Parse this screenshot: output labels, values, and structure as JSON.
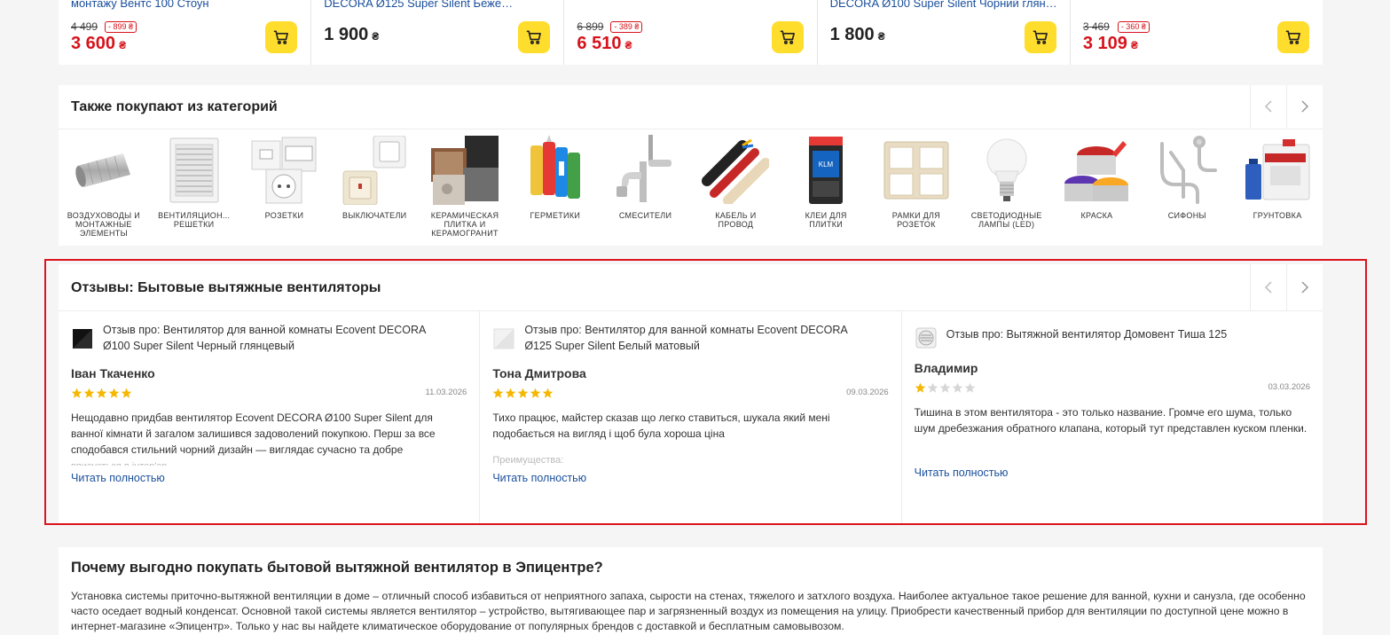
{
  "products": [
    {
      "name": "монтажу Вентс 100 Стоун",
      "old_price": "4 499",
      "discount": "- 899 ₴",
      "price": "3 600",
      "currency": "₴",
      "on_sale": true
    },
    {
      "name": "DECORA Ø125 Super Silent Бежеви...",
      "price": "1 900",
      "currency": "₴",
      "on_sale": false
    },
    {
      "name": "",
      "old_price": "6 899",
      "discount": "- 389 ₴",
      "price": "6 510",
      "currency": "₴",
      "on_sale": true
    },
    {
      "name": "DECORA Ø100 Super Silent Чорний глянцевий",
      "price": "1 800",
      "currency": "₴",
      "on_sale": false
    },
    {
      "name": "",
      "old_price": "3 469",
      "discount": "- 360 ₴",
      "price": "3 109",
      "currency": "₴",
      "on_sale": true
    }
  ],
  "categories": {
    "title": "Также покупают из категорий",
    "items": [
      {
        "label": "Воздуховоды и монтажные элементы",
        "icon": "duct-icon"
      },
      {
        "label": "Вентиляцион... решетки",
        "icon": "vent-grille-icon"
      },
      {
        "label": "Розетки",
        "icon": "socket-icon"
      },
      {
        "label": "Выключатели",
        "icon": "switch-icon"
      },
      {
        "label": "Керамическая плитка и керамогранит",
        "icon": "tile-icon"
      },
      {
        "label": "Герметики",
        "icon": "sealant-icon"
      },
      {
        "label": "Смесители",
        "icon": "faucet-icon"
      },
      {
        "label": "Кабель и провод",
        "icon": "cable-icon"
      },
      {
        "label": "Клеи для плитки",
        "icon": "glue-bag-icon"
      },
      {
        "label": "Рамки для розеток",
        "icon": "frame-icon"
      },
      {
        "label": "Светодиодные лампы (LED)",
        "icon": "led-bulb-icon"
      },
      {
        "label": "Краска",
        "icon": "paint-icon"
      },
      {
        "label": "Сифоны",
        "icon": "siphon-icon"
      },
      {
        "label": "Грунтовка",
        "icon": "primer-icon"
      }
    ]
  },
  "reviews": {
    "title": "Отзывы: Бытовые вытяжные вентиляторы",
    "read_more": "Читать полностью",
    "items": [
      {
        "product": "Отзыв про: Вентилятор для ванной комнаты Ecovent DECORA Ø100 Super Silent Черный глянцевый",
        "author": "Іван Ткаченко",
        "rating": 5,
        "date": "11.03.2026",
        "text": "Нещодавно придбав вентилятор Ecovent DECORA Ø100 Super Silent для ванної кімнати й загалом залишився задоволений покупкою. Перш за все сподобався стильний чорний дизайн — виглядає сучасно та добре",
        "fade": "вписується в інтер'єр",
        "thumb": "black"
      },
      {
        "product": "Отзыв про: Вентилятор для ванной комнаты Ecovent DECORA Ø125 Super Silent Белый матовый",
        "author": "Тона Дмитрова",
        "rating": 5,
        "date": "09.03.2026",
        "text": "Тихо працює, майстер сказав що легко ставиться, шукала який мені подобається на вигляд і щоб була хороша ціна",
        "fade": "Преимущества:",
        "thumb": "white"
      },
      {
        "product": "Отзыв про: Вытяжной вентилятор Домовент Тиша 125",
        "author": "Владимир",
        "rating": 1,
        "date": "03.03.2026",
        "text": "Тишина в этом вентилятора - это только название. Громче его шума, только шум дребезжания обратного клапана, который тут представлен куском пленки.",
        "fade": "",
        "thumb": "grille"
      }
    ]
  },
  "why": {
    "title": "Почему выгодно покупать бытовой вытяжной вентилятор в Эпицентре?",
    "text": "Установка системы приточно-вытяжной вентиляции в доме – отличный способ избавиться от неприятного запаха, сырости на стенах, тяжелого и затхлого воздуха. Наиболее актуальное такое решение для ванной, кухни и санузла, где особенно часто оседает водный конденсат. Основной такой системы является вентилятор – устройство, вытягивающее пар и загрязненный воздух из помещения на улицу. Приобрести качественный прибор для вентиляции по доступной цене можно в интернет-магазине «Эпицентр». Только у нас вы найдете климатическое оборудование от популярных брендов с доставкой и бесплатным самовывозом."
  },
  "colors": {
    "accent_red": "#d6131b",
    "cart_yellow": "#ffdd2d",
    "link_blue": "#1a4f9c",
    "star_gold": "#f5b700",
    "frame_red": "#d9141c"
  }
}
